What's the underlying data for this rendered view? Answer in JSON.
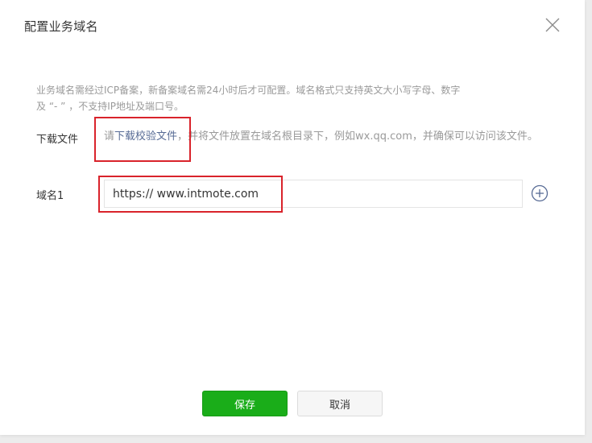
{
  "dialog": {
    "title": "配置业务域名",
    "close_icon": "close-icon"
  },
  "intro": {
    "line1": "业务域名需经过ICP备案，新备案域名需24小时后才可配置。域名格式只支持英文大小写字母、数字",
    "line2": "及 “- ” ，不支持IP地址及端口号。"
  },
  "download": {
    "label": "下载文件",
    "prefix": "请",
    "link_text": "下载校验文件",
    "suffix": "，并将文件放置在域名根目录下，例如wx.qq.com，并确保可以访问该文件。"
  },
  "domain": {
    "label": "域名1",
    "value": "https:// www.intmote.com",
    "add_icon": "plus-circle-icon"
  },
  "buttons": {
    "save_label": "保存",
    "cancel_label": "取消"
  },
  "colors": {
    "primary_green": "#1aad19",
    "link_blue": "#576b95",
    "highlight_red": "#d9232b",
    "muted_text": "#9a9a9a"
  }
}
